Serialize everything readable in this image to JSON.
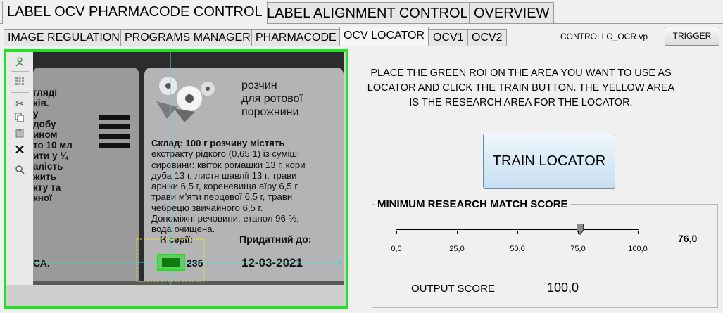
{
  "top_tabs": [
    "LABEL OCV PHARMACODE CONTROL",
    "LABEL ALIGNMENT CONTROL",
    "OVERVIEW"
  ],
  "sub_tabs": [
    "IMAGE REGULATION",
    "PROGRAMS MANAGER",
    "PHARMACODE",
    "OCV LOCATOR",
    "OCV1",
    "OCV2"
  ],
  "active_top_tab": "LABEL OCV PHARMACODE CONTROL",
  "active_sub_tab": "OCV LOCATOR",
  "filename": "CONTROLLO_OCR.vp",
  "trigger_label": "TRIGGER",
  "instructions": "PLACE THE GREEN ROI ON THE AREA YOU WANT TO USE AS LOCATOR AND CLICK THE TRAIN BUTTON. THE YELLOW AREA IS THE RESEARCH AREA FOR THE LOCATOR.",
  "train_button_label": "TRAIN LOCATOR",
  "score_group": {
    "title": "MINIMUM RESEARCH MATCH SCORE",
    "slider": {
      "min": 0,
      "max": 100,
      "value": 76.0,
      "ticks": [
        "0,0",
        "25,0",
        "50,0",
        "75,0",
        "100,0"
      ]
    },
    "value_display": "76,0"
  },
  "output": {
    "label": "OUTPUT SCORE",
    "value": "100,0"
  },
  "toolbar_icons": [
    "roi-person-icon",
    "grid-icon",
    "cut-icon",
    "copy-icon",
    "paste-icon",
    "delete-x-icon",
    "zoom-icon"
  ],
  "image_text": {
    "left_lines": [
      "гляді",
      "ків.",
      "у",
      "добу",
      "ином",
      "то 10 мл",
      "ити у ¼",
      "аліcть",
      "жить",
      "кту та",
      "кнoї"
    ],
    "right_title": [
      "розчин",
      "для ротової",
      "порожнини"
    ],
    "body": [
      "Склад: 100 г розчину містять",
      "екстракту рідкого (0,65:1) із суміші",
      "сировини: квіток ромашки 13 г, кори",
      "дуба 13 г, листя шавлії 13 г, трави",
      "арніки 6,5 г, кореневища аїру 6,5 г,",
      "трави м'яти перцевої 6,5 г, трави",
      "чебрецю звичайного 6,5 г.",
      "Допоміжні речовини: етанол 96 %,",
      "вода очищена."
    ],
    "series_label": "Н серії:",
    "series_value": "235",
    "expiry_label": "Придатний до:",
    "expiry_value": "12-03-2021",
    "left_bottom": "СА."
  },
  "colors": {
    "roi_green": "#22e022",
    "research_yellow": "#f0e030",
    "crosshair_cyan": "#29e0e8"
  }
}
